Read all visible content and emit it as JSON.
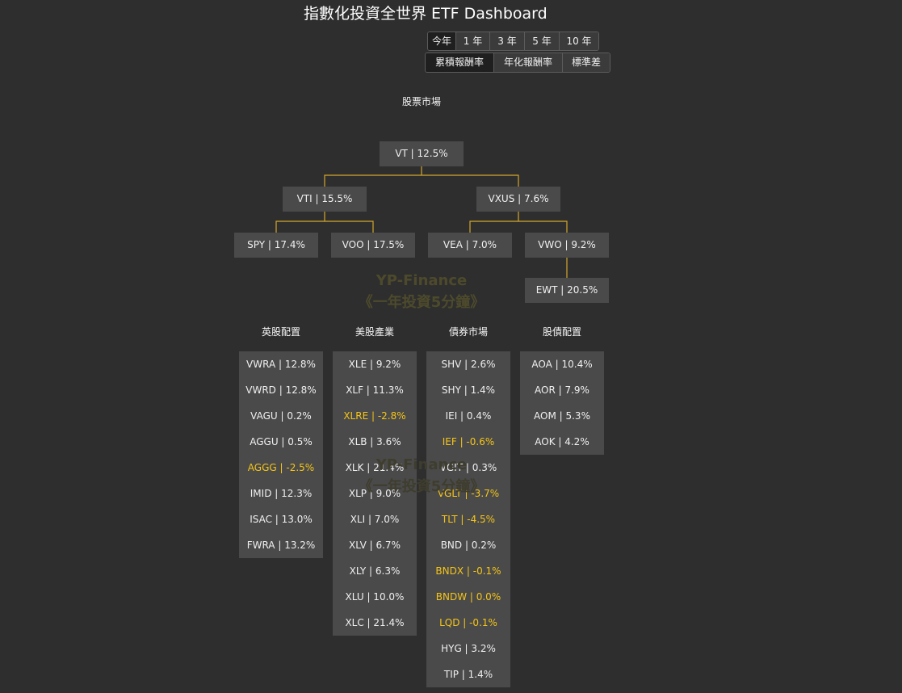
{
  "title": "指數化投資全世界 ETF Dashboard",
  "period_buttons": [
    {
      "label": "今年",
      "active": true
    },
    {
      "label": "1 年",
      "active": false
    },
    {
      "label": "3 年",
      "active": false
    },
    {
      "label": "5 年",
      "active": false
    },
    {
      "label": "10 年",
      "active": false
    }
  ],
  "metric_buttons": [
    {
      "label": "累積報酬率",
      "active": true
    },
    {
      "label": "年化報酬率",
      "active": false
    },
    {
      "label": "標準差",
      "active": false
    }
  ],
  "stock_market": {
    "title": "股票市場",
    "nodes": {
      "vt": "VT | 12.5%",
      "vti": "VTI | 15.5%",
      "vxus": "VXUS | 7.6%",
      "spy": "SPY | 17.4%",
      "voo": "VOO | 17.5%",
      "vea": "VEA | 7.0%",
      "vwo": "VWO | 9.2%",
      "ewt": "EWT | 20.5%"
    }
  },
  "watermark": {
    "line1": "YP-Finance",
    "line2": "《一年投資5分鐘》"
  },
  "columns": [
    {
      "title": "英股配置",
      "items": [
        {
          "label": "VWRA | 12.8%",
          "negative": false
        },
        {
          "label": "VWRD | 12.8%",
          "negative": false
        },
        {
          "label": "VAGU | 0.2%",
          "negative": false
        },
        {
          "label": "AGGU | 0.5%",
          "negative": false
        },
        {
          "label": "AGGG | -2.5%",
          "negative": true
        },
        {
          "label": "IMID | 12.3%",
          "negative": false
        },
        {
          "label": "ISAC | 13.0%",
          "negative": false
        },
        {
          "label": "FWRA | 13.2%",
          "negative": false
        }
      ]
    },
    {
      "title": "美股產業",
      "items": [
        {
          "label": "XLE | 9.2%",
          "negative": false
        },
        {
          "label": "XLF | 11.3%",
          "negative": false
        },
        {
          "label": "XLRE | -2.8%",
          "negative": true
        },
        {
          "label": "XLB | 3.6%",
          "negative": false
        },
        {
          "label": "XLK | 21.4%",
          "negative": false
        },
        {
          "label": "XLP | 9.0%",
          "negative": false
        },
        {
          "label": "XLI | 7.0%",
          "negative": false
        },
        {
          "label": "XLV | 6.7%",
          "negative": false
        },
        {
          "label": "XLY | 6.3%",
          "negative": false
        },
        {
          "label": "XLU | 10.0%",
          "negative": false
        },
        {
          "label": "XLC | 21.4%",
          "negative": false
        }
      ]
    },
    {
      "title": "債券市場",
      "items": [
        {
          "label": "SHV | 2.6%",
          "negative": false
        },
        {
          "label": "SHY | 1.4%",
          "negative": false
        },
        {
          "label": "IEI | 0.4%",
          "negative": false
        },
        {
          "label": "IEF | -0.6%",
          "negative": true
        },
        {
          "label": "VGIT | 0.3%",
          "negative": false
        },
        {
          "label": "VGLT | -3.7%",
          "negative": true
        },
        {
          "label": "TLT | -4.5%",
          "negative": true
        },
        {
          "label": "BND | 0.2%",
          "negative": false
        },
        {
          "label": "BNDX | -0.1%",
          "negative": true
        },
        {
          "label": "BNDW | 0.0%",
          "negative": true
        },
        {
          "label": "LQD | -0.1%",
          "negative": true
        },
        {
          "label": "HYG | 3.2%",
          "negative": false
        },
        {
          "label": "TIP | 1.4%",
          "negative": false
        }
      ]
    },
    {
      "title": "股債配置",
      "items": [
        {
          "label": "AOA | 10.4%",
          "negative": false
        },
        {
          "label": "AOR | 7.9%",
          "negative": false
        },
        {
          "label": "AOM | 5.3%",
          "negative": false
        },
        {
          "label": "AOK | 4.2%",
          "negative": false
        }
      ]
    }
  ],
  "colors": {
    "background": "#2e2e2e",
    "node": "#4a4a4a",
    "negative": "#f5c518",
    "connector": "#d4a72c"
  }
}
